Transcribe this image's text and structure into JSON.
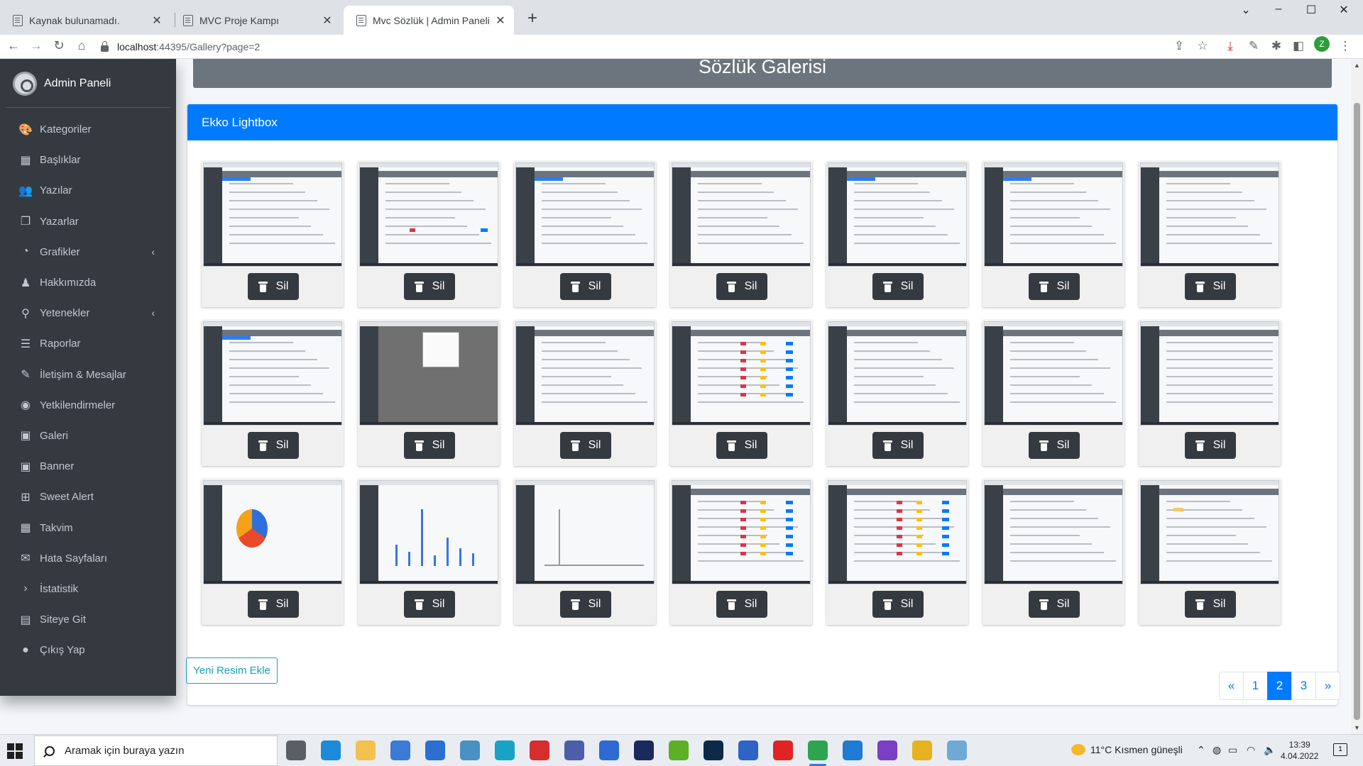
{
  "browser": {
    "tabs": [
      {
        "title": "Kaynak bulunamadı.",
        "active": false
      },
      {
        "title": "MVC Proje Kampı",
        "active": false
      },
      {
        "title": "Mvc Sözlük | Admin Paneli",
        "active": true
      }
    ],
    "new_tab_label": "+",
    "window_controls": [
      "⌄",
      "–",
      "☐",
      "✕"
    ],
    "url_host": "localhost",
    "url_rest": ":44395/Gallery?page=2",
    "profile_initial": "Z"
  },
  "sidebar": {
    "brand": "Admin Paneli",
    "items": [
      {
        "label": "Kategoriler",
        "icon": "palette-icon",
        "glyph": "🎨",
        "chevron": false
      },
      {
        "label": "Başlıklar",
        "icon": "grid-icon",
        "glyph": "▦",
        "chevron": false
      },
      {
        "label": "Yazılar",
        "icon": "users-icon",
        "glyph": "👥",
        "chevron": false
      },
      {
        "label": "Yazarlar",
        "icon": "copy-icon",
        "glyph": "❐",
        "chevron": false
      },
      {
        "label": "Grafikler",
        "icon": "pie-chart-icon",
        "glyph": "◔",
        "chevron": true
      },
      {
        "label": "Hakkımızda",
        "icon": "chess-icon",
        "glyph": "♟",
        "chevron": false
      },
      {
        "label": "Yetenekler",
        "icon": "award-icon",
        "glyph": "⚲",
        "chevron": true
      },
      {
        "label": "Raporlar",
        "icon": "bars-icon",
        "glyph": "☰",
        "chevron": false
      },
      {
        "label": "İletişim & Mesajlar",
        "icon": "edit-icon",
        "glyph": "✎",
        "chevron": false
      },
      {
        "label": "Yetkilendirmeler",
        "icon": "user-circle-icon",
        "glyph": "◉",
        "chevron": false
      },
      {
        "label": "Galeri",
        "icon": "image-icon",
        "glyph": "▣",
        "chevron": false
      },
      {
        "label": "Banner",
        "icon": "image-icon",
        "glyph": "▣",
        "chevron": false
      },
      {
        "label": "Sweet Alert",
        "icon": "map-icon",
        "glyph": "⊞",
        "chevron": false
      },
      {
        "label": "Takvim",
        "icon": "calendar-icon",
        "glyph": "▦",
        "chevron": false
      },
      {
        "label": "Hata Sayfaları",
        "icon": "envelope-icon",
        "glyph": "✉",
        "chevron": false
      },
      {
        "label": "İstatistik",
        "icon": "terminal-icon",
        "glyph": "›",
        "chevron": false
      },
      {
        "label": "Siteye Git",
        "icon": "document-icon",
        "glyph": "▤",
        "chevron": false
      },
      {
        "label": "Çıkış Yap",
        "icon": "apple-icon",
        "glyph": "●",
        "chevron": false
      }
    ],
    "chevron_glyph": "‹"
  },
  "page": {
    "header_title": "Sözlük Galerisi",
    "card_title": "Ekko Lightbox",
    "delete_label": "Sil",
    "add_button_label": "Yeni Resim Ekle"
  },
  "gallery": {
    "items": [
      {
        "kind": "table"
      },
      {
        "kind": "form"
      },
      {
        "kind": "table"
      },
      {
        "kind": "list"
      },
      {
        "kind": "table"
      },
      {
        "kind": "table"
      },
      {
        "kind": "header"
      },
      {
        "kind": "table"
      },
      {
        "kind": "modal"
      },
      {
        "kind": "header"
      },
      {
        "kind": "badges"
      },
      {
        "kind": "header"
      },
      {
        "kind": "header"
      },
      {
        "kind": "text"
      },
      {
        "kind": "pie"
      },
      {
        "kind": "bars"
      },
      {
        "kind": "line"
      },
      {
        "kind": "badges"
      },
      {
        "kind": "badges"
      },
      {
        "kind": "header"
      },
      {
        "kind": "calendar"
      }
    ]
  },
  "pagination": {
    "prev": "«",
    "pages": [
      "1",
      "2",
      "3"
    ],
    "current": "2",
    "next": "»"
  },
  "taskbar": {
    "search_placeholder": "Aramak için buraya yazın",
    "weather": "11°C  Kısmen güneşli",
    "time": "13:39",
    "date": "4.04.2022",
    "notifications": "1",
    "apps": [
      {
        "name": "task-view-icon",
        "color": "#5a5f66"
      },
      {
        "name": "edge-icon",
        "color": "#1c8ad8"
      },
      {
        "name": "file-explorer-icon",
        "color": "#f2c14e"
      },
      {
        "name": "store-icon",
        "color": "#3a7bd5"
      },
      {
        "name": "mail-icon",
        "color": "#2b6fd1"
      },
      {
        "name": "app-icon",
        "color": "#4a90c2"
      },
      {
        "name": "app-icon",
        "color": "#18a3c6"
      },
      {
        "name": "app-icon",
        "color": "#d62d2d"
      },
      {
        "name": "app-icon",
        "color": "#4c5ea8"
      },
      {
        "name": "app-icon",
        "color": "#2d6ad1"
      },
      {
        "name": "app-icon",
        "color": "#1a2a5a"
      },
      {
        "name": "app-icon",
        "color": "#5bb024"
      },
      {
        "name": "photoshop-icon",
        "color": "#0b2a4a"
      },
      {
        "name": "app-icon",
        "color": "#2f63c4"
      },
      {
        "name": "opera-icon",
        "color": "#e02424"
      },
      {
        "name": "chrome-icon",
        "color": "#2ea44f",
        "active": true
      },
      {
        "name": "vscode-icon",
        "color": "#1f7ad1"
      },
      {
        "name": "visual-studio-icon",
        "color": "#7a3fc2"
      },
      {
        "name": "app-icon",
        "color": "#e6b21f"
      },
      {
        "name": "app-icon",
        "color": "#6fa9d6"
      }
    ]
  }
}
